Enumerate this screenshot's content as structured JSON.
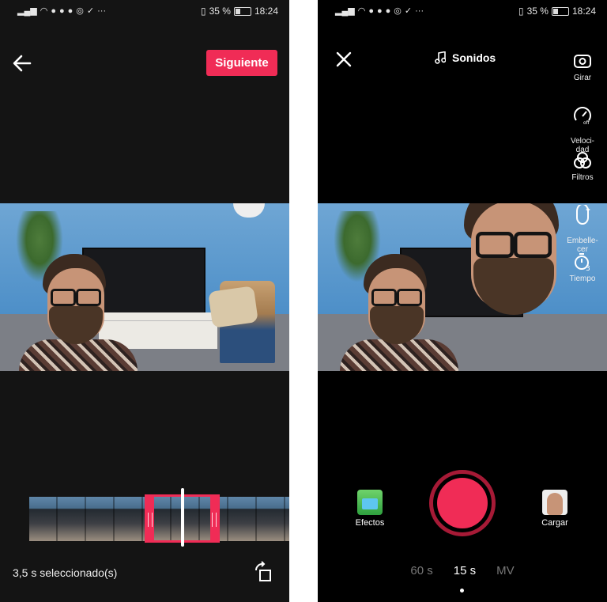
{
  "left_screen": {
    "status_bar": {
      "battery": "35 %",
      "time": "18:24"
    },
    "header": {
      "next_label": "Siguiente"
    },
    "footer": {
      "selection_text": "3,5 s seleccionado(s)"
    }
  },
  "right_screen": {
    "status_bar": {
      "battery": "35 %",
      "time": "18:24"
    },
    "header": {
      "sounds_label": "Sonidos"
    },
    "side_tools": [
      {
        "label": "Girar",
        "icon": "flip-camera-icon"
      },
      {
        "label": "Veloci-\ndad",
        "icon": "speed-icon",
        "status": "off"
      },
      {
        "label": "Filtros",
        "icon": "filters-icon"
      },
      {
        "label": "Embelle-\ncer",
        "icon": "beautify-icon"
      },
      {
        "label": "Tiempo",
        "icon": "timer-icon",
        "timer_value": "3"
      }
    ],
    "bottom": {
      "effects_label": "Efectos",
      "upload_label": "Cargar",
      "modes": [
        "60 s",
        "15 s",
        "MV"
      ],
      "active_mode": "15 s"
    }
  },
  "colors": {
    "accent": "#f02c56",
    "record_ring": "#a61a36",
    "background": "#000000"
  }
}
